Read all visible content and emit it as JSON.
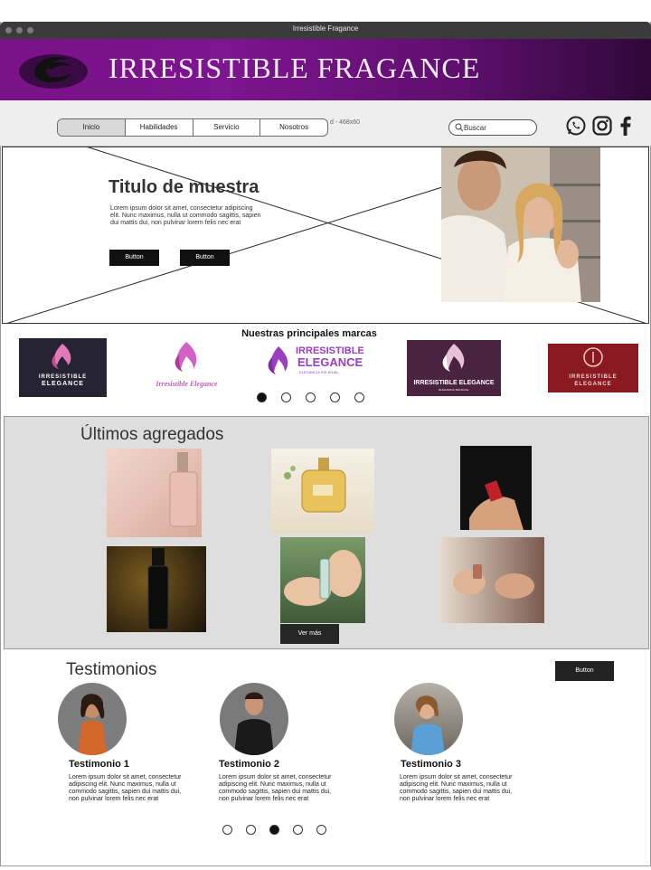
{
  "window": {
    "title": "Irresistible Fragance"
  },
  "banner": {
    "brand": "IRRESISTIBLE FRAGANCE"
  },
  "nav": {
    "items": [
      "Inicio",
      "Habilidades",
      "Servicio",
      "Nosotros"
    ],
    "active": "Inicio",
    "ad_label": "d - 468x60",
    "search_placeholder": "Buscar"
  },
  "social": [
    "whatsapp-icon",
    "instagram-icon",
    "facebook-icon"
  ],
  "hero": {
    "title": "Titulo de muestra",
    "text": "Lorem ipsum dolor sit amet, consectetur adipiscing elit. Nunc maximus, nulla ut commodo sagittis, sapien dui mattis dui, non pulvinar lorem felis nec erat",
    "button1": "Button",
    "button2": "Button"
  },
  "brands": {
    "title": "Nuestras principales marcas",
    "logos": [
      {
        "name": "IRRESISTIBLE",
        "sub": "ELEGANCE"
      },
      {
        "name": "Irresistible Elegance",
        "sub": ""
      },
      {
        "name": "IRRESISTIBLE",
        "sub": "ELEGANCE",
        "tag": "ELEGANCIA SIN IGUAL"
      },
      {
        "name": "IRRESISTIBLE ELEGANCE",
        "sub": "ELEGANCIA SIN IGUAL"
      },
      {
        "name": "IRRESISTIBLE",
        "sub": "ELEGANCE"
      }
    ],
    "active_dot": 1,
    "dot_count": 5
  },
  "latest": {
    "title": "Últimos agregados",
    "button": "Ver más"
  },
  "testimonials": {
    "title": "Testimonios",
    "button": "Button",
    "items": [
      {
        "name": "Testimonio 1",
        "text": "Lorem ipsum dolor sit amet, consectetur adipiscing elit. Nunc maximus, nulla ut commodo sagittis, sapien dui mattis dui, non pulvinar lorem felis nec erat"
      },
      {
        "name": "Testimonio 2",
        "text": "Lorem ipsum dolor sit amet, consectetur adipiscing elit. Nunc maximus, nulla ut commodo sagittis, sapien dui mattis dui, non pulvinar lorem felis nec erat"
      },
      {
        "name": "Testimonio 3",
        "text": "Lorem ipsum dolor sit amet, consectetur adipiscing elit. Nunc maximus, nulla ut commodo sagittis, sapien dui mattis dui, non pulvinar lorem felis nec erat"
      }
    ],
    "active_dot": 3,
    "dot_count": 5
  },
  "colors": {
    "brand_purple": "#7a1288",
    "button": "#111111",
    "section_gray": "#dedede"
  }
}
